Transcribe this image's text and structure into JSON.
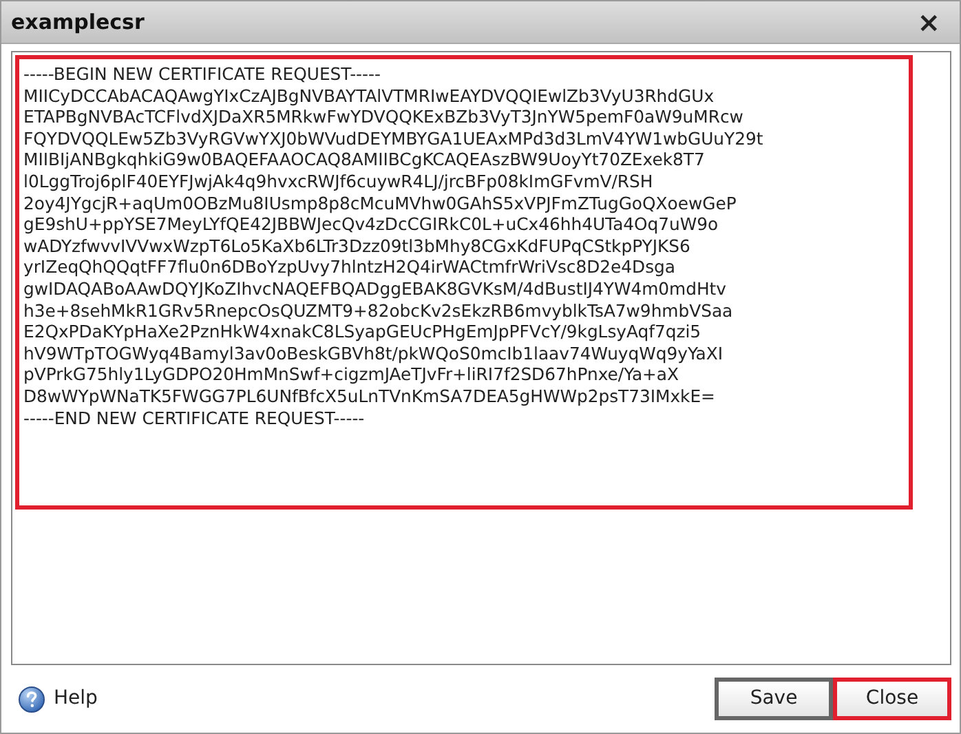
{
  "window": {
    "title": "examplecsr",
    "close_glyph": "×"
  },
  "csr": {
    "highlighted": true,
    "lines": [
      "-----BEGIN NEW CERTIFICATE REQUEST-----",
      "MIICyDCCAbACAQAwgYIxCzAJBgNVBAYTAlVTMRIwEAYDVQQIEwlZb3VyU3RhdGUx",
      "ETAPBgNVBAcTCFlvdXJDaXR5MRkwFwYDVQQKExBZb3VyT3JnYW5pemF0aW9uMRcw",
      "FQYDVQQLEw5Zb3VyRGVwYXJ0bWVudDEYMBYGA1UEAxMPd3d3LmV4YW1wbGUuY29t",
      "MIIBIjANBgkqhkiG9w0BAQEFAAOCAQ8AMIIBCgKCAQEAszBW9UoyYt70ZExek8T7",
      "l0LggTroj6plF40EYFJwjAk4q9hvxcRWJf6cuywR4LJ/jrcBFp08kImGFvmV/RSH",
      "2oy4JYgcjR+aqUm0OBzMu8IUsmp8p8cMcuMVhw0GAhS5xVPJFmZTugGoQXoewGeP",
      "gE9shU+ppYSE7MeyLYfQE42JBBWJecQv4zDcCGIRkC0L+uCx46hh4UTa4Oq7uW9o",
      "wADYzfwvvIVVwxWzpT6Lo5KaXb6LTr3Dzz09tl3bMhy8CGxKdFUPqCStkpPYJKS6",
      "yrIZeqQhQQqtFF7flu0n6DBoYzpUvy7hlntzH2Q4irWACtmfrWriVsc8D2e4Dsga",
      "gwIDAQABoAAwDQYJKoZIhvcNAQEFBQADggEBAK8GVKsM/4dBustIJ4YW4m0mdHtv",
      "h3e+8sehMkR1GRv5RnepcOsQUZMT9+82obcKv2sEkzRB6mvyblkTsA7w9hmbVSaa",
      "E2QxPDaKYpHaXe2PznHkW4xnakC8LSyapGEUcPHgEmJpPFVcY/9kgLsyAqf7qzi5",
      "hV9WTpTOGWyq4Bamyl3av0oBeskGBVh8t/pkWQoS0mcIb1laav74WuyqWq9yYaXI",
      "pVPrkG75hly1LyGDPO20HmMnSwf+cigzmJAeTJvFr+liRI7f2SD67hPnxe/Ya+aX",
      "D8wWYpWNaTK5FWGG7PL6UNfBfcX5uLnTVnKmSA7DEA5gHWWp2psT73IMxkE=",
      "-----END NEW CERTIFICATE REQUEST-----"
    ]
  },
  "footer": {
    "help": "Help",
    "buttons": [
      {
        "label": "Save",
        "kind": "default",
        "highlighted": false
      },
      {
        "label": "Close",
        "kind": "plain",
        "highlighted": true
      }
    ]
  }
}
